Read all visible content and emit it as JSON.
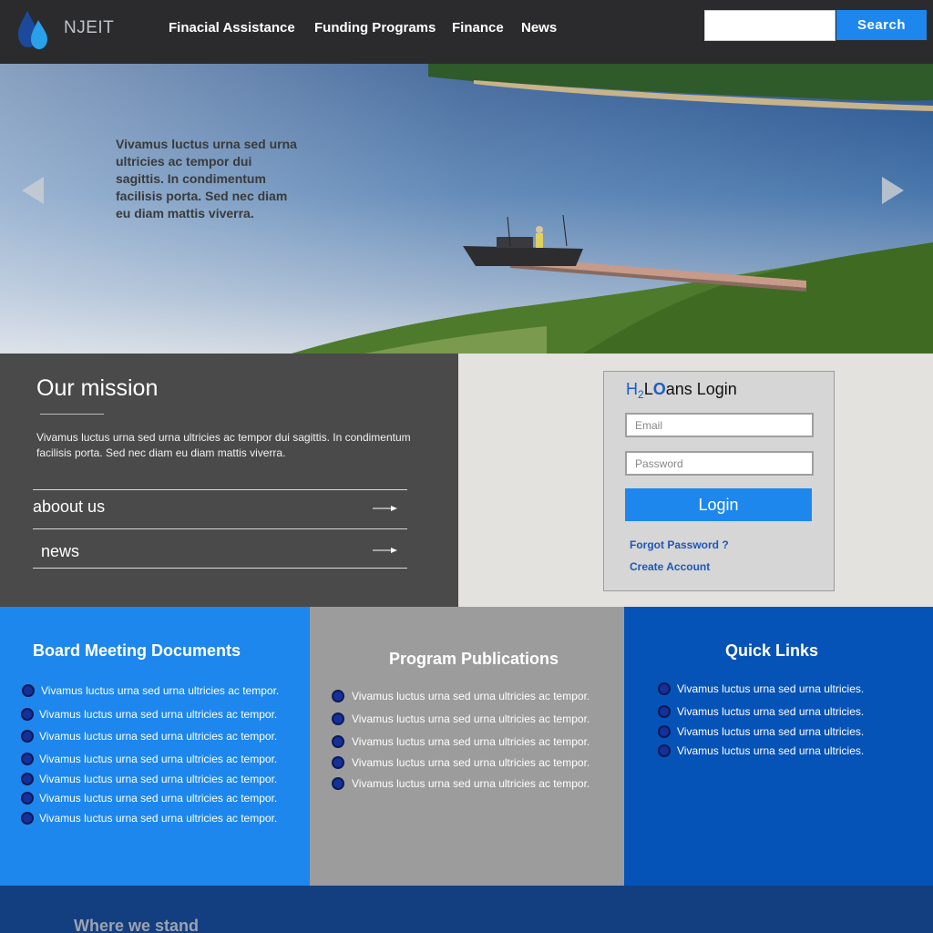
{
  "header": {
    "brand": "NJEIT",
    "logo_icon": "water-drops-icon",
    "nav": [
      "Finacial Assistance",
      "Funding Programs",
      "Finance",
      "News"
    ],
    "search_placeholder": "",
    "search_label": "Search"
  },
  "hero": {
    "text": "Vivamus luctus urna sed urna ultricies ac tempor dui sagittis. In condimentum facilisis porta. Sed nec diam eu diam mattis viverra.",
    "prev_icon": "triangle-left-icon",
    "next_icon": "triangle-right-icon"
  },
  "mission": {
    "title": "Our mission",
    "text": "Vivamus luctus urna sed urna ultricies ac tempor dui sagittis. In condimentum facilisis porta. Sed nec diam eu diam mattis viverra.",
    "links": [
      "aboout us",
      "news"
    ],
    "link_icon": "arrow-right-icon"
  },
  "login": {
    "title_h": "H",
    "title_sub": "2",
    "title_l": "L",
    "title_o": "O",
    "title_rest": "ans Login",
    "email_placeholder": "Email",
    "password_placeholder": "Password",
    "button_label": "Login",
    "forgot_label": "Forgot Password ?",
    "create_label": "Create Account"
  },
  "columns": [
    {
      "title": "Board Meeting Documents",
      "items": [
        "Vivamus luctus urna sed urna ultricies ac tempor.",
        "Vivamus luctus urna sed urna ultricies ac tempor.",
        "Vivamus luctus urna sed urna ultricies ac tempor.",
        "Vivamus luctus urna sed urna ultricies ac tempor.",
        "Vivamus luctus urna sed urna ultricies ac tempor.",
        "Vivamus luctus urna sed urna ultricies ac tempor.",
        "Vivamus luctus urna sed urna ultricies ac tempor."
      ]
    },
    {
      "title": "Program Publications",
      "items": [
        "Vivamus luctus urna sed urna ultricies ac tempor.",
        "Vivamus luctus urna sed urna ultricies ac tempor.",
        "Vivamus luctus urna sed urna ultricies ac tempor.",
        "Vivamus luctus urna sed urna ultricies ac tempor.",
        "Vivamus luctus urna sed urna ultricies ac tempor."
      ]
    },
    {
      "title": "Quick Links",
      "items": [
        "Vivamus luctus urna sed urna ultricies.",
        "Vivamus luctus urna sed urna ultricies.",
        "Vivamus luctus urna sed urna ultricies.",
        "Vivamus luctus urna sed urna ultricies."
      ]
    }
  ],
  "footer": {
    "title": "Where we stand"
  },
  "colors": {
    "header_bg": "#2b2b2d",
    "accent_blue": "#1d87ee",
    "dark_blue": "#0653b8",
    "navy": "#133e80",
    "mission_bg": "#4a4a4a",
    "login_bg": "#e4e2de",
    "gray_column": "#9c9c9c"
  }
}
